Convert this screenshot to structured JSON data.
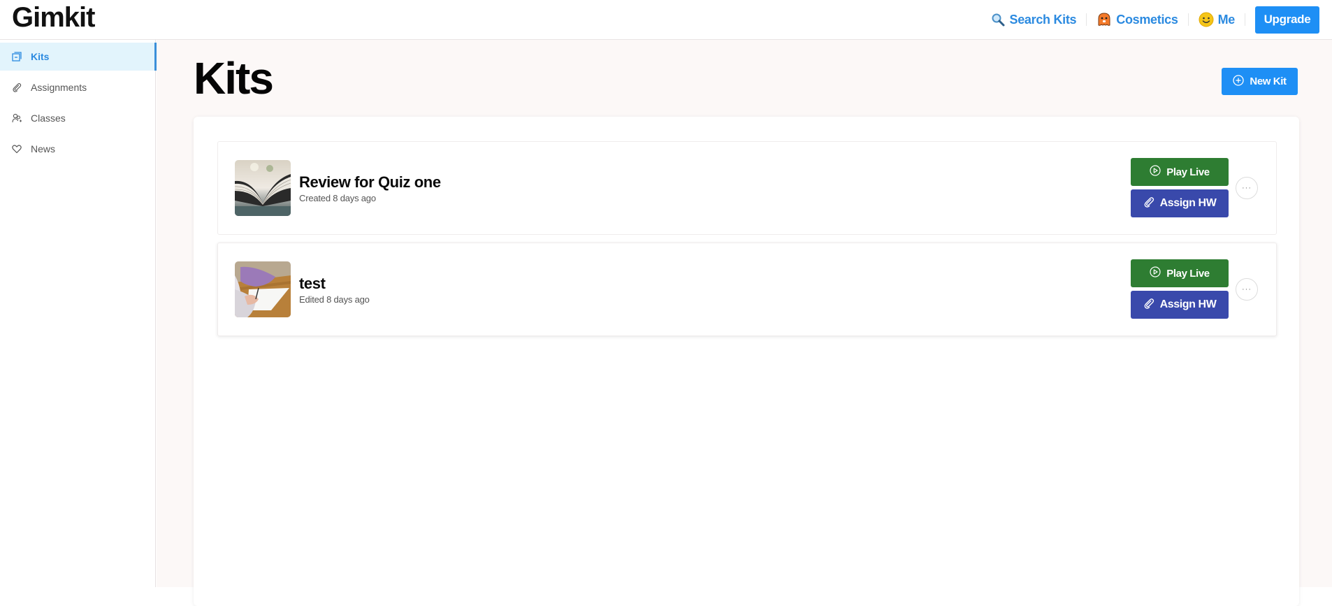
{
  "app": {
    "logo": "Gimkit"
  },
  "header": {
    "nav": [
      {
        "label": "Search Kits",
        "icon": "magnifier-icon"
      },
      {
        "label": "Cosmetics",
        "icon": "gim-character-icon"
      },
      {
        "label": "Me",
        "icon": "smiley-face-icon"
      }
    ],
    "upgrade_label": "Upgrade"
  },
  "sidebar": {
    "items": [
      {
        "label": "Kits",
        "icon": "kits-icon",
        "active": true
      },
      {
        "label": "Assignments",
        "icon": "paperclip-icon",
        "active": false
      },
      {
        "label": "Classes",
        "icon": "users-icon",
        "active": false
      },
      {
        "label": "News",
        "icon": "heart-icon",
        "active": false
      }
    ]
  },
  "main": {
    "title": "Kits",
    "new_kit_label": "New Kit",
    "kits": [
      {
        "title": "Review for Quiz one",
        "meta": "Created 8 days ago",
        "thumbnail": "open-book-photo",
        "play_label": "Play Live",
        "assign_label": "Assign HW",
        "more_label": "···"
      },
      {
        "title": "test",
        "meta": "Edited 8 days ago",
        "thumbnail": "student-writing-photo",
        "play_label": "Play Live",
        "assign_label": "Assign HW",
        "more_label": "···"
      }
    ]
  },
  "colors": {
    "brand_blue": "#1e8ff5",
    "link_blue": "#2b8ae0",
    "play_green": "#2e7d32",
    "assign_indigo": "#3949ab",
    "active_bg": "#e2f4fc"
  }
}
